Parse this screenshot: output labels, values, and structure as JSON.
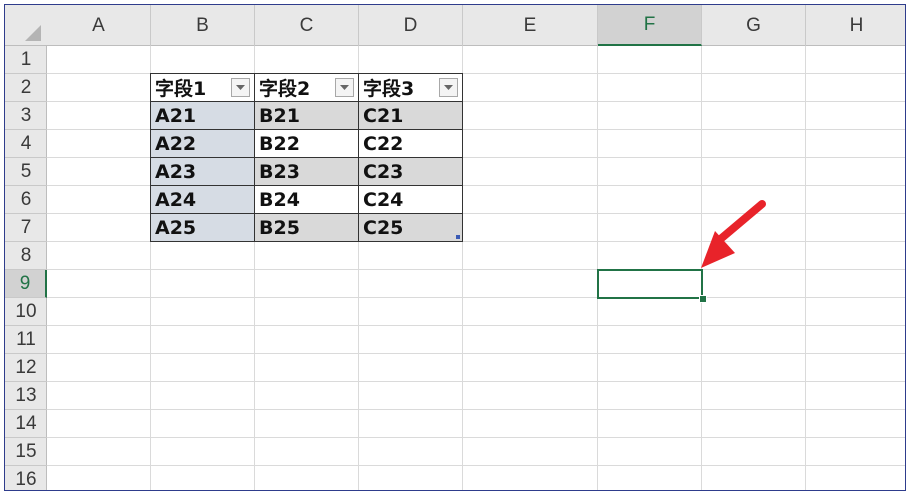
{
  "columns": [
    "A",
    "B",
    "C",
    "D",
    "E",
    "F",
    "G",
    "H"
  ],
  "rows": [
    "1",
    "2",
    "3",
    "4",
    "5",
    "6",
    "7",
    "8",
    "9",
    "10",
    "11",
    "12",
    "13",
    "14",
    "15",
    "16"
  ],
  "selected": {
    "column": "F",
    "row": "9"
  },
  "table": {
    "headers": [
      "字段1",
      "字段2",
      "字段3"
    ],
    "body": [
      [
        "A21",
        "B21",
        "C21"
      ],
      [
        "A22",
        "B22",
        "C22"
      ],
      [
        "A23",
        "B23",
        "C23"
      ],
      [
        "A24",
        "B24",
        "C24"
      ],
      [
        "A25",
        "B25",
        "C25"
      ]
    ]
  },
  "colors": {
    "accent_green": "#217346",
    "arrow_red": "#e8232a",
    "first_column_fill": "#d6dce4",
    "band_fill": "#d9d9d9"
  },
  "icons": {
    "filter_dropdown": "chevron-down-icon",
    "annotation": "red-arrow-icon",
    "select_all": "select-all-triangle-icon"
  }
}
